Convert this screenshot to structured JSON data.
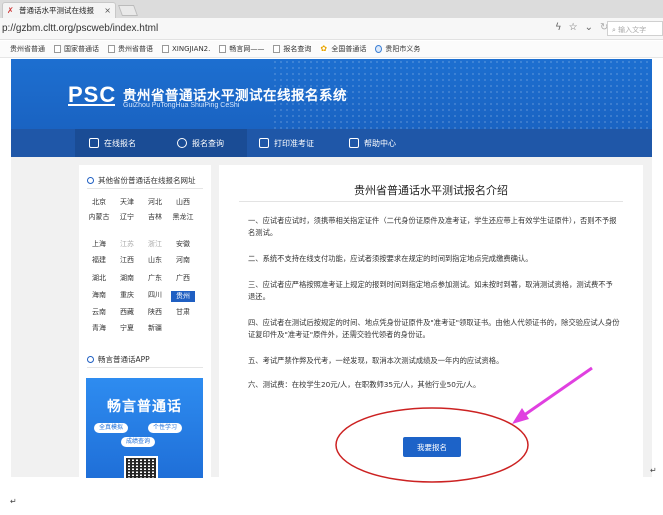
{
  "browser": {
    "tab_title": "普通话水平测试在线报",
    "url": "p://gzbm.cltt.org/pscweb/index.html",
    "search_placeholder": "输入文字",
    "bookmarks": [
      "贵州省普通",
      "国家普通话",
      "贵州省普语",
      "XINGJIAN2.",
      "畅言网——",
      "报名查询",
      "全国普通话",
      "贵阳市义务"
    ]
  },
  "site": {
    "logo": "PSC",
    "title": "贵州省普通话水平测试在线报名系统",
    "subtitle": "GuiZhou PuTongHua ShuiPing CeShi"
  },
  "nav": [
    {
      "label": "在线报名"
    },
    {
      "label": "报名查询"
    },
    {
      "label": "打印准考证"
    },
    {
      "label": "帮助中心"
    }
  ],
  "sidebar": {
    "province_title": "其他省份普通话在线报名网址",
    "provinces": [
      [
        "北京",
        "天津",
        "河北",
        "山西"
      ],
      [
        "内蒙古",
        "辽宁",
        "吉林",
        "黑龙江"
      ],
      [
        "上海",
        "江苏",
        "浙江",
        "安徽"
      ],
      [
        "福建",
        "江西",
        "山东",
        "河南"
      ],
      [
        "湖北",
        "湖南",
        "广东",
        "广西"
      ],
      [
        "海南",
        "重庆",
        "四川",
        "贵州"
      ],
      [
        "云南",
        "西藏",
        "陕西",
        "甘肃"
      ],
      [
        "青海",
        "宁夏",
        "新疆",
        ""
      ]
    ],
    "selected_province": "贵州",
    "app_title": "畅言普通话APP",
    "app_banner": "畅言普通话",
    "app_pills": [
      "全真模拟",
      "个性学习",
      "成绩查询"
    ]
  },
  "main": {
    "title": "贵州省普通话水平测试报名介绍",
    "paragraphs": [
      "一、应试者应试时，须携带相关指定证件（二代身份证原件及准考证，学生还应带上有效学生证原件），否则不予报名测试。",
      "二、系统不支持在线支付功能，应试者须按要求在规定的时间到指定地点完成缴费确认。",
      "三、应试者应严格按照准考证上规定的报到时间到指定地点参加测试。如未按时到著，取消测试资格，测试费不予退还。",
      "四、应试者在测试后按规定的时间、地点凭身份证原件及\"准考证\"领取证书。由他人代领证书的，除交验应试人身份证复印件及\"准考证\"原件外，还需交验代领者的身份证。",
      "五、考试严禁作弊及代考，一经发现，取消本次测试成绩及一年内的应试资格。",
      "六、测试费：在校学生20元/人，在职教师35元/人，其他行业50元/人。"
    ],
    "register_button": "我要报名"
  },
  "annotation_colors": {
    "ellipse": "#cc2222",
    "arrow": "#e040e0"
  }
}
